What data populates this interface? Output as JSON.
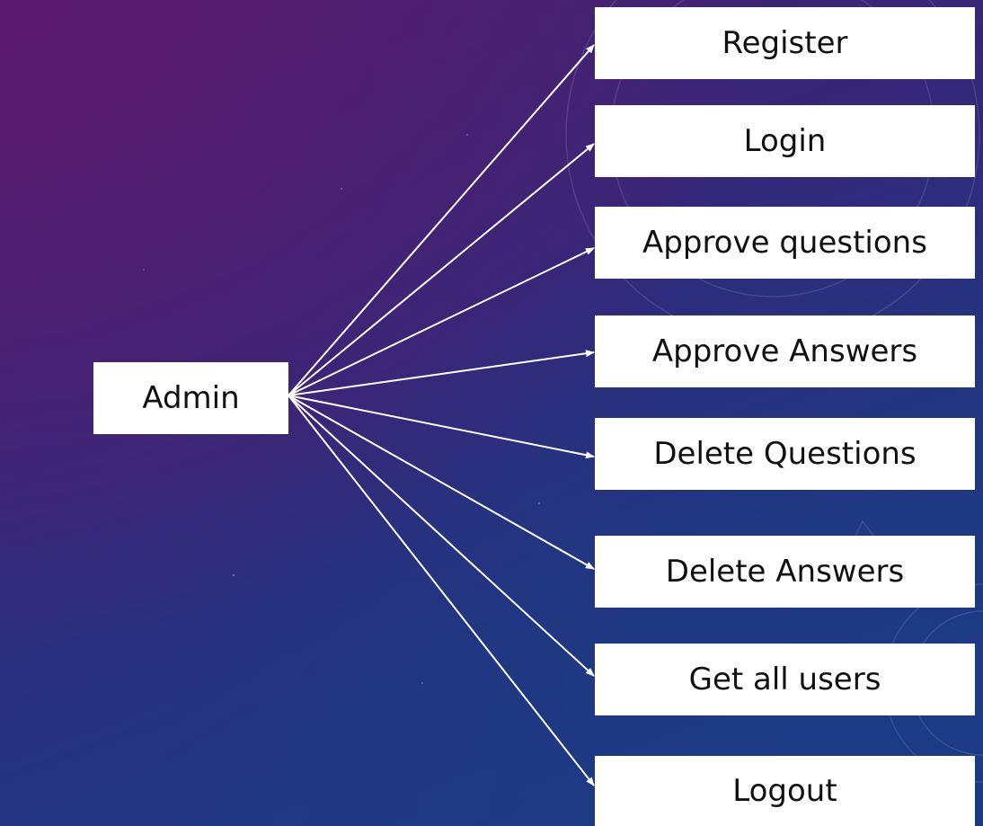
{
  "diagram": {
    "source": {
      "label": "Admin"
    },
    "targets": [
      {
        "label": "Register"
      },
      {
        "label": "Login"
      },
      {
        "label": "Approve questions"
      },
      {
        "label": "Approve Answers"
      },
      {
        "label": "Delete Questions"
      },
      {
        "label": "Delete Answers"
      },
      {
        "label": "Get all users"
      },
      {
        "label": "Logout"
      }
    ]
  },
  "colors": {
    "node_fill": "#ffffff",
    "node_text": "#111111",
    "arrow": "#ffffff",
    "background_top": "#4a1f6d",
    "background_bottom": "#1f3d85"
  }
}
